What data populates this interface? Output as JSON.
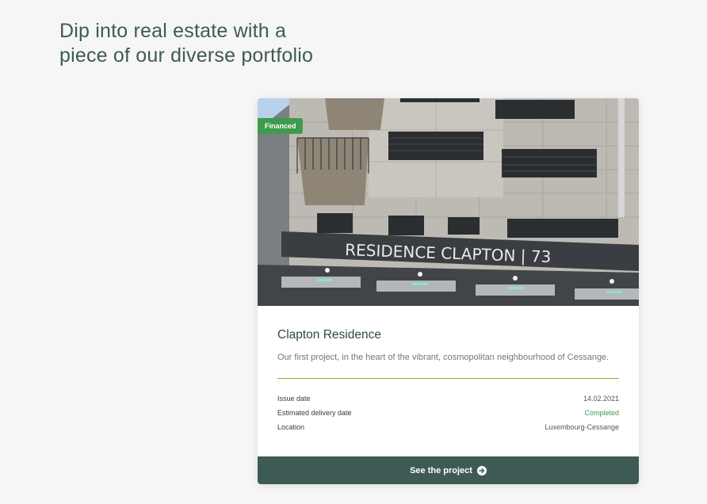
{
  "headline": {
    "line1": "Dip into real estate with a",
    "line2": "piece of our diverse portfolio"
  },
  "card": {
    "badge": "Financed",
    "image_sign": "RESIDENCE CLAPTON | 73",
    "title": "Clapton Residence",
    "description": "Our first project, in the heart of the vibrant, cosmopolitan neighbourhood of Cessange.",
    "details": [
      {
        "label": "Issue date",
        "value": "14.02.2021"
      },
      {
        "label": "Estimated delivery date",
        "value": "Completed"
      },
      {
        "label": "Location",
        "value": "Luxembourg-Cessange"
      }
    ],
    "cta_label": "See the project",
    "cta_icon": "arrow-right-circle-icon"
  },
  "colors": {
    "page_background": "#f6f6f6",
    "heading": "#3f5a54",
    "badge_green": "#3f9a4e",
    "divider_olive": "#a7a52a",
    "cta_background": "#3e5a54"
  }
}
